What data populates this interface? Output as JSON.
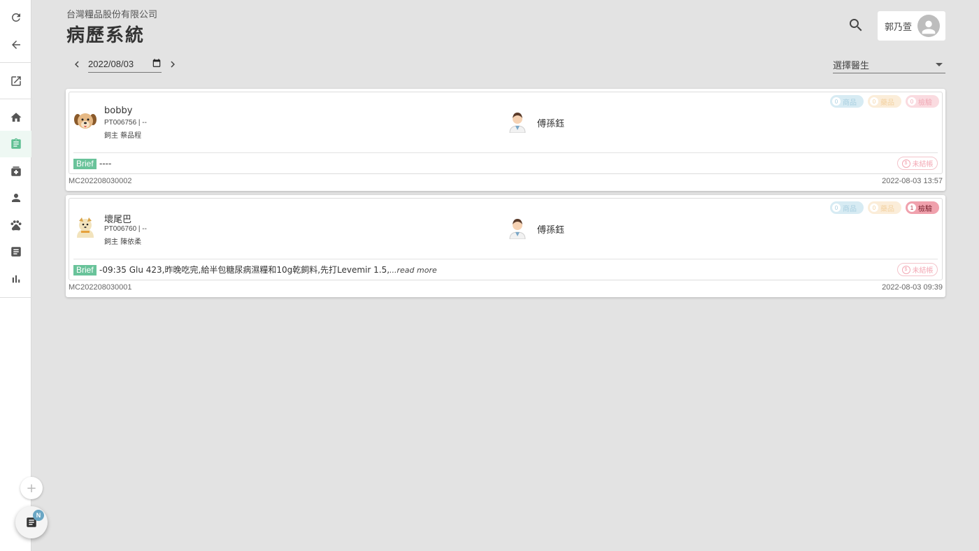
{
  "header": {
    "company": "台灣糧品股份有限公司",
    "title": "病歷系統",
    "user_name": "郭乃萱"
  },
  "filters": {
    "date": "2022/08/03",
    "doctor_select_label": "選擇醫生"
  },
  "sidebar": {
    "items": [
      {
        "icon": "refresh-icon"
      },
      {
        "icon": "back-arrow-icon"
      },
      {
        "icon": "open-in-new-icon"
      },
      {
        "icon": "home-icon"
      },
      {
        "icon": "clipboard-icon",
        "active": true
      },
      {
        "icon": "medical-box-icon"
      },
      {
        "icon": "person-icon"
      },
      {
        "icon": "paw-icon"
      },
      {
        "icon": "document-icon"
      },
      {
        "icon": "bar-chart-icon"
      }
    ],
    "fab_badge": "N"
  },
  "records": [
    {
      "pet_name": "bobby",
      "pet_id": "PT006756 | --",
      "owner": "飼主 蔡品程",
      "doctor": "傅孫鈺",
      "pills": [
        {
          "count": "0",
          "label": "商品"
        },
        {
          "count": "0",
          "label": "藥品"
        },
        {
          "count": "0",
          "label": "檢驗"
        }
      ],
      "brief_tag": "Brief",
      "brief": "----",
      "read_more": "",
      "status": "未結帳",
      "record_id": "MC202208030002",
      "time": "2022-08-03 13:57"
    },
    {
      "pet_name": "壞尾巴",
      "pet_id": "PT006760 | --",
      "owner": "飼主 陳依柔",
      "doctor": "傅孫鈺",
      "pills": [
        {
          "count": "0",
          "label": "商品"
        },
        {
          "count": "0",
          "label": "藥品"
        },
        {
          "count": "1",
          "label": "檢驗"
        }
      ],
      "brief_tag": "Brief",
      "brief": "-09:35 Glu 423,昨晚吃完,給半包糖尿病濕糧和10g乾飼料,先打Levemir 1.5,",
      "read_more": "...read more",
      "status": "未結帳",
      "record_id": "MC202208030001",
      "time": "2022-08-03 09:39"
    }
  ],
  "colors": {
    "accent": "#69c39a",
    "background": "#e3e3e3",
    "test_active": "#f0a1ad"
  }
}
